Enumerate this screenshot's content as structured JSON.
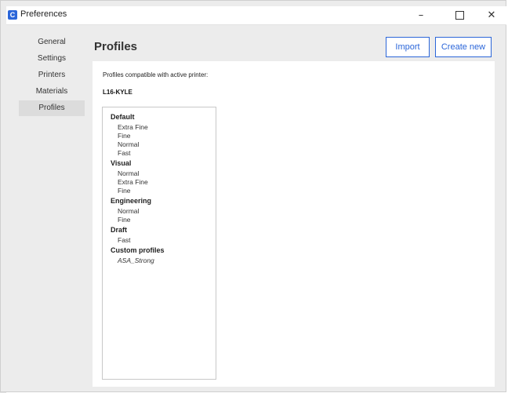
{
  "window": {
    "title": "Preferences",
    "app_icon_glyph": "C",
    "minimize_glyph": "–",
    "close_glyph": "✕"
  },
  "sidebar": {
    "items": [
      {
        "label": "General"
      },
      {
        "label": "Settings"
      },
      {
        "label": "Printers"
      },
      {
        "label": "Materials"
      },
      {
        "label": "Profiles"
      }
    ],
    "active": "Profiles"
  },
  "page": {
    "title": "Profiles",
    "import_label": "Import",
    "create_new_label": "Create new",
    "compat_label": "Profiles compatible with active printer:",
    "printer_name": "L16-KYLE"
  },
  "profiles": {
    "groups": [
      {
        "label": "Default",
        "items": [
          "Extra Fine",
          "Fine",
          "Normal",
          "Fast"
        ]
      },
      {
        "label": "Visual",
        "items": [
          "Normal",
          "Extra Fine",
          "Fine"
        ]
      },
      {
        "label": "Engineering",
        "items": [
          "Normal",
          "Fine"
        ]
      },
      {
        "label": "Draft",
        "items": [
          "Fast"
        ]
      },
      {
        "label": "Custom profiles",
        "items": [
          "ASA_Strong"
        ]
      }
    ]
  },
  "colors": {
    "accent": "#2b66d9",
    "window_bg": "#ececec",
    "panel_bg": "#ffffff",
    "active_sidebar": "#dcdcdc"
  }
}
